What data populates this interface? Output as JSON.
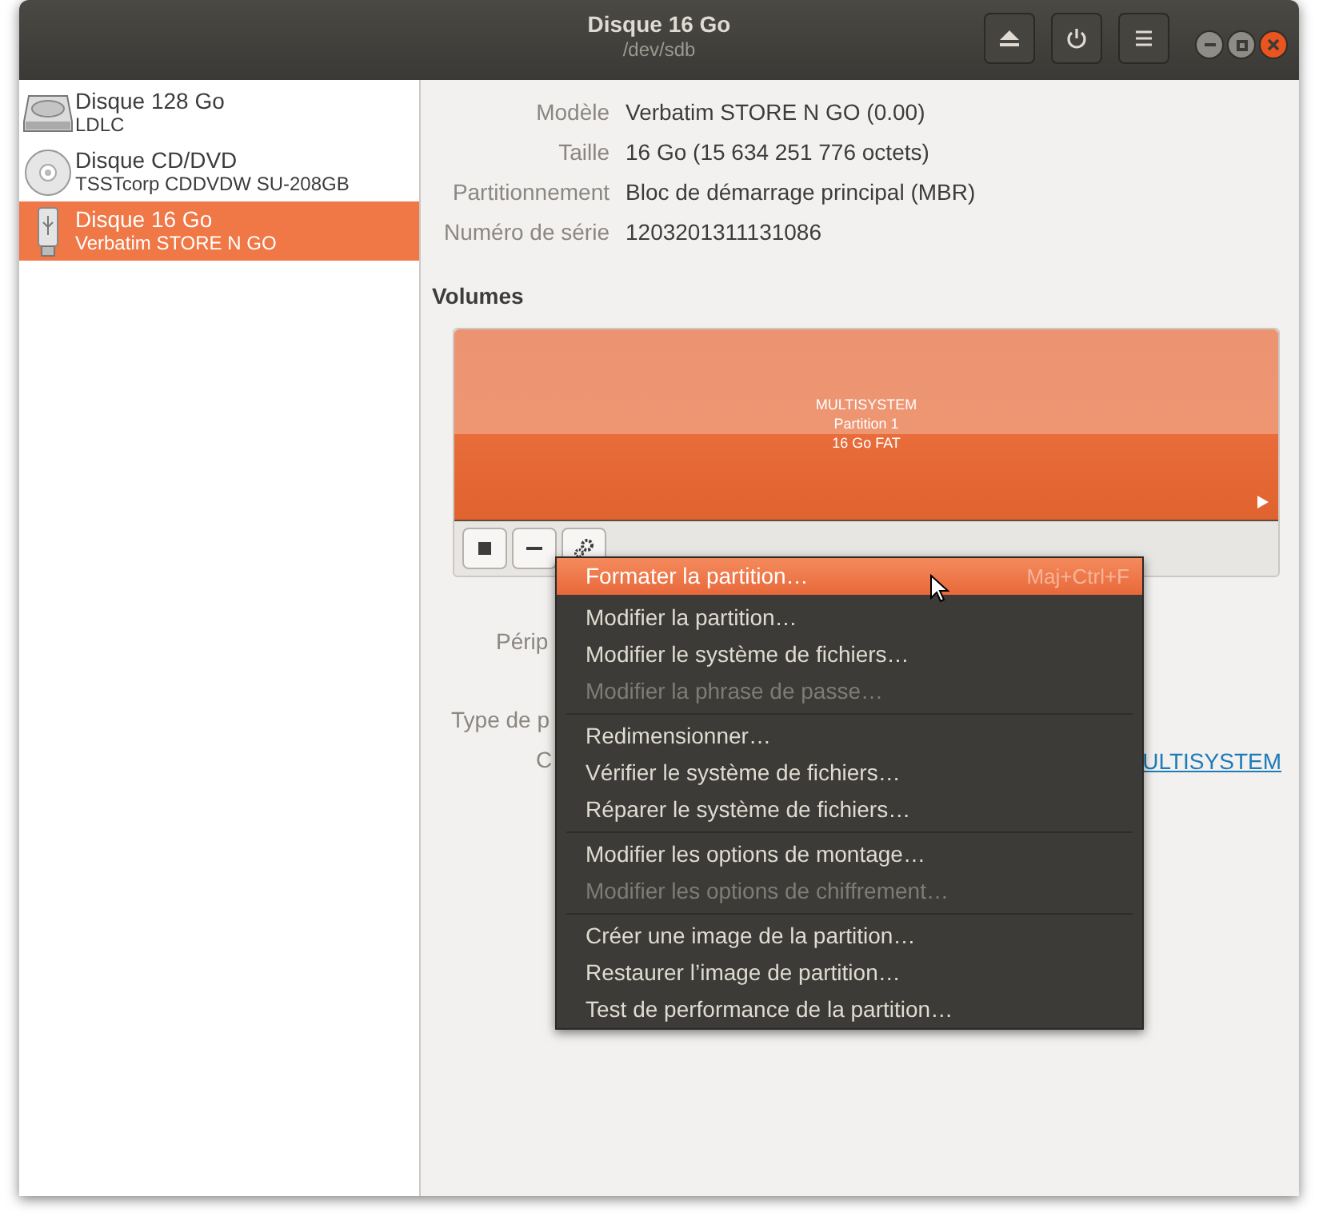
{
  "window": {
    "title": "Disque 16 Go",
    "subtitle": "/dev/sdb"
  },
  "sidebar": {
    "items": [
      {
        "kind": "harddisk",
        "title": "Disque 128 Go",
        "subtitle": "LDLC",
        "selected": false
      },
      {
        "kind": "optical",
        "title": "Disque CD/DVD",
        "subtitle": "TSSTcorp CDDVDW SU-208GB",
        "selected": false
      },
      {
        "kind": "usb",
        "title": "Disque 16 Go",
        "subtitle": "Verbatim STORE N GO",
        "selected": true
      }
    ]
  },
  "details": [
    {
      "label": "Modèle",
      "value": "Verbatim STORE N GO (0.00)"
    },
    {
      "label": "Taille",
      "value": "16 Go (15 634 251 776 octets)"
    },
    {
      "label": "Partitionnement",
      "value": "Bloc de démarrage principal (MBR)"
    },
    {
      "label": "Numéro de série",
      "value": "1203201311131086"
    }
  ],
  "volumes": {
    "heading": "Volumes",
    "partition": {
      "lines": [
        "MULTISYSTEM",
        "Partition 1",
        "16 Go FAT"
      ]
    }
  },
  "partition_details": {
    "label_1": "Périp",
    "label_2": "Type de p",
    "label_3": "C",
    "link": "ULTISYSTEM"
  },
  "context_menu": {
    "groups": [
      [
        {
          "label": "Formater la partition…",
          "shortcut": "Maj+Ctrl+F",
          "selected": true,
          "disabled": false
        },
        {
          "label": "Modifier la partition…",
          "selected": false,
          "disabled": false
        },
        {
          "label": "Modifier le système de fichiers…",
          "selected": false,
          "disabled": false
        },
        {
          "label": "Modifier la phrase de passe…",
          "selected": false,
          "disabled": true
        }
      ],
      [
        {
          "label": "Redimensionner…",
          "selected": false,
          "disabled": false
        },
        {
          "label": "Vérifier le système de fichiers…",
          "selected": false,
          "disabled": false
        },
        {
          "label": "Réparer le système de fichiers…",
          "selected": false,
          "disabled": false
        }
      ],
      [
        {
          "label": "Modifier les options de montage…",
          "selected": false,
          "disabled": false
        },
        {
          "label": "Modifier les options de chiffrement…",
          "selected": false,
          "disabled": true
        }
      ],
      [
        {
          "label": "Créer une image de la partition…",
          "selected": false,
          "disabled": false
        },
        {
          "label": "Restaurer l’image de partition…",
          "selected": false,
          "disabled": false
        },
        {
          "label": "Test de performance de la partition…",
          "selected": false,
          "disabled": false
        }
      ]
    ]
  }
}
